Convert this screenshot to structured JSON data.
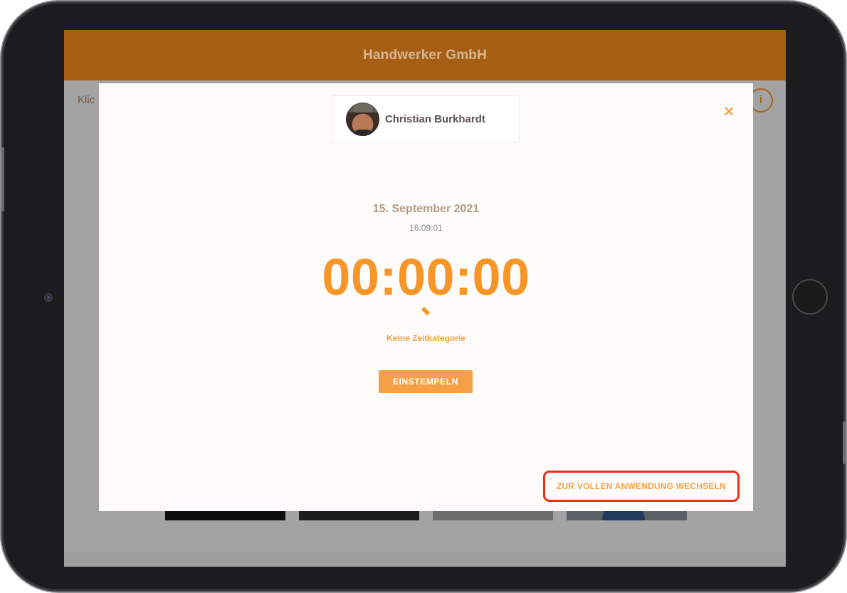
{
  "app": {
    "title": "Handwerker GmbH",
    "hint": "Klic",
    "info_label": "i"
  },
  "modal": {
    "close_label": "×",
    "employee_name": "Christian Burkhardt",
    "date": "15. September 2021",
    "time": "16:09:01",
    "timer": "00:00:00",
    "category": "Keine Zeitkategorie",
    "stamp_button": "EINSTEMPELN",
    "switch_link": "ZUR VOLLEN ANWENDUNG WECHSELN"
  },
  "colors": {
    "header_bg": "#a65e14",
    "accent": "#f79526",
    "highlight_border": "#ea2f17"
  }
}
